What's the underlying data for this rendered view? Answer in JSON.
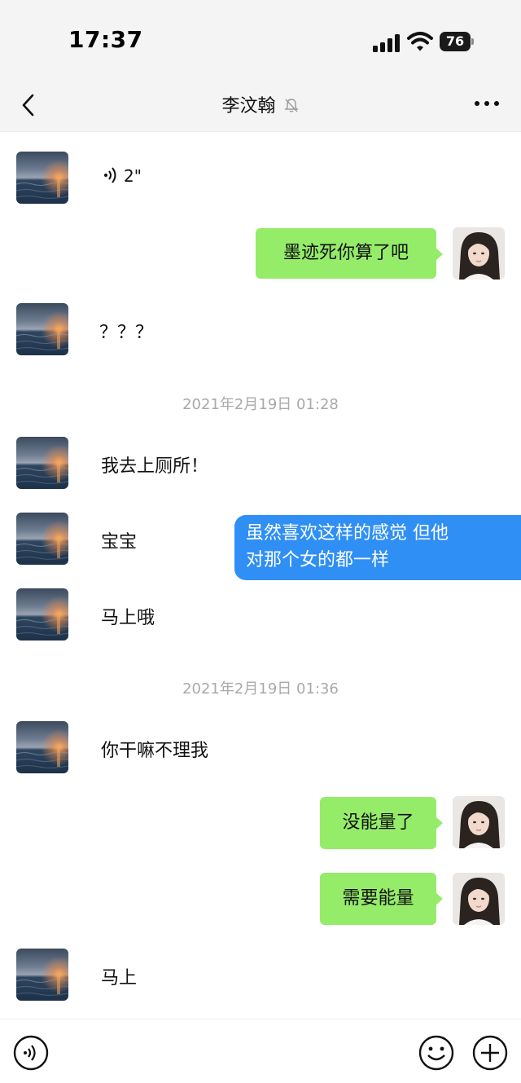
{
  "status": {
    "time": "17:37",
    "battery": "76"
  },
  "nav": {
    "title": "李汶翰",
    "back_icon": "chevron-left-icon",
    "mute_icon": "bell-mute-icon",
    "more_icon": "ellipsis-icon"
  },
  "messages": {
    "voice_duration": "2\"",
    "sent_1": "墨迹死你算了吧",
    "recv_2": "？？？",
    "time_1": "2021年2月19日 01:28",
    "recv_3": "我去上厕所！",
    "recv_4": "宝宝",
    "overlay_line_1": "虽然喜欢这样的感觉 但他",
    "overlay_line_2": "对那个女的都一样",
    "recv_5": "马上哦",
    "time_2": "2021年2月19日 01:36",
    "recv_6": "你干嘛不理我",
    "sent_2": "没能量了",
    "sent_3": "需要能量",
    "recv_7": "马上"
  },
  "colors": {
    "sent_bubble": "#95ec69",
    "overlay_bubble": "#2f8ff5",
    "header_bg": "#f4f4f4"
  },
  "bottom": {
    "voice_icon": "voice-icon",
    "emoji_icon": "emoji-icon",
    "plus_icon": "plus-icon"
  }
}
